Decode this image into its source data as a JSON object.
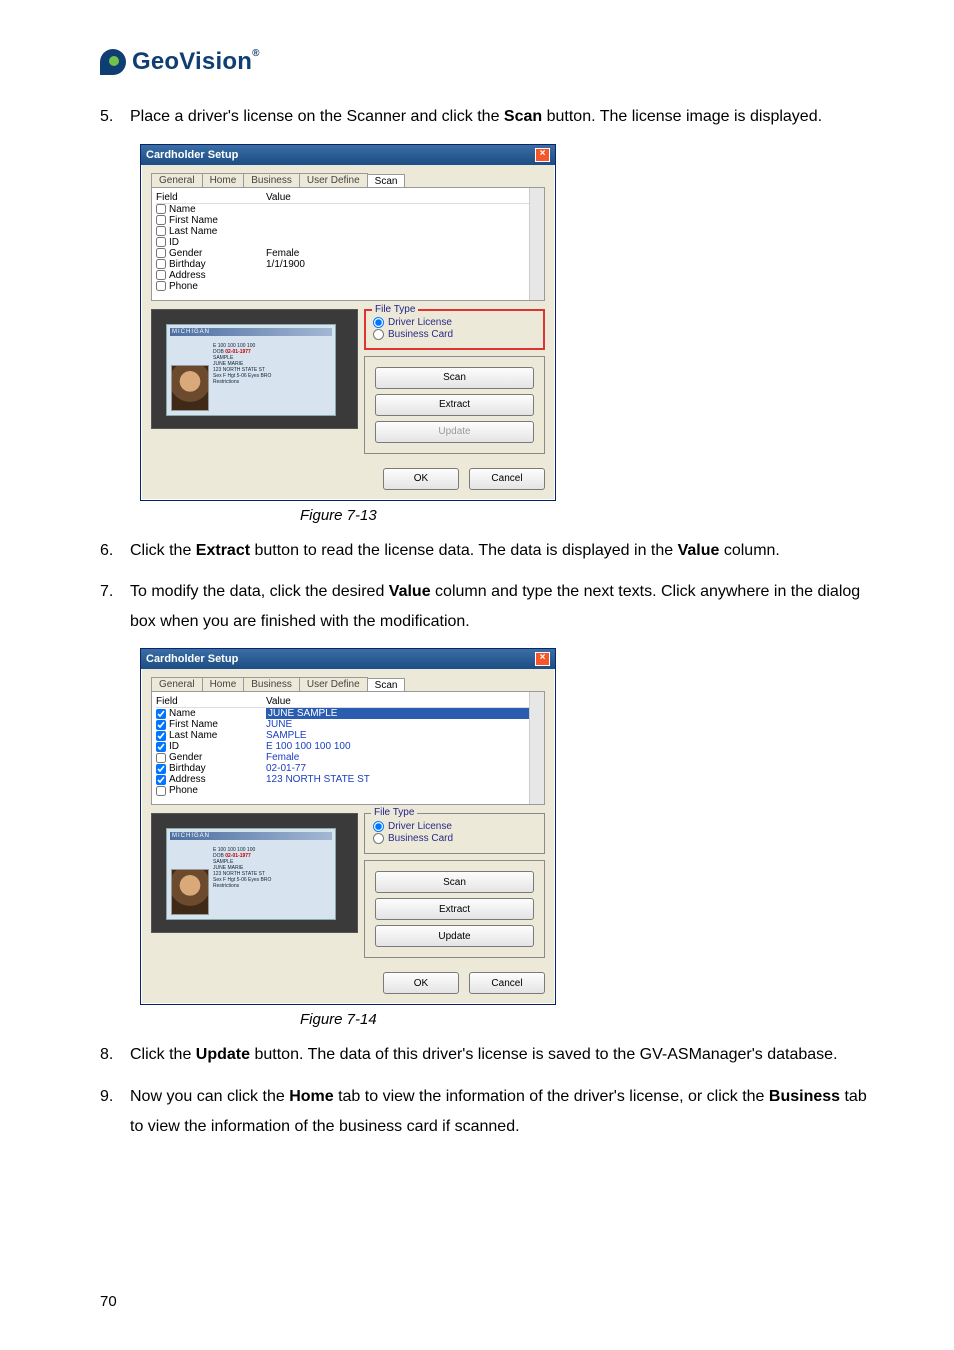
{
  "logo": {
    "text": "GeoVision",
    "tm": "®"
  },
  "steps": {
    "s5": {
      "num": "5.",
      "text_a": "Place a driver's license on the Scanner and click the ",
      "b1": "Scan",
      "text_b": " button. The license image is displayed."
    },
    "s6": {
      "num": "6.",
      "text_a": "Click the ",
      "b1": "Extract",
      "text_b": " button to read the license data. The data is displayed in the ",
      "b2": "Value",
      "text_c": " column."
    },
    "s7": {
      "num": "7.",
      "text_a": "To modify the data, click the desired ",
      "b1": "Value",
      "text_b": " column and type the next texts. Click anywhere in the dialog box when you are finished with the modification."
    },
    "s8": {
      "num": "8.",
      "text_a": "Click the ",
      "b1": "Update",
      "text_b": " button. The data of this driver's license is saved to the GV-ASManager's database."
    },
    "s9": {
      "num": "9.",
      "text_a": "Now you can click the ",
      "b1": "Home",
      "text_b": " tab to view the information of the driver's license, or click the ",
      "b2": "Business",
      "text_c": " tab to view the information of the business card if scanned."
    }
  },
  "captions": {
    "c1": "Figure 7-13",
    "c2": "Figure 7-14"
  },
  "page_number": "70",
  "dialog": {
    "title": "Cardholder Setup",
    "tabs": {
      "general": "General",
      "home": "Home",
      "business": "Business",
      "user": "User Define",
      "scan": "Scan"
    },
    "headers": {
      "field": "Field",
      "value": "Value"
    },
    "fields": {
      "name": "Name",
      "first": "First Name",
      "last": "Last Name",
      "id": "ID",
      "gender": "Gender",
      "birthday": "Birthday",
      "address": "Address",
      "phone": "Phone"
    },
    "filetype": {
      "legend": "File Type",
      "driver": "Driver License",
      "bcard": "Business Card"
    },
    "buttons": {
      "scan": "Scan",
      "extract": "Extract",
      "update": "Update",
      "ok": "OK",
      "cancel": "Cancel"
    },
    "license_bar": "MICHIGAN"
  },
  "d1": {
    "rows": {
      "name": "",
      "first": "",
      "last": "",
      "id": "",
      "gender": "Female",
      "birthday": "1/1/1900",
      "address": "",
      "phone": ""
    },
    "checked": {
      "name": false,
      "first": false,
      "last": false,
      "id": false,
      "gender": false,
      "birthday": false,
      "address": false,
      "phone": false
    },
    "update_disabled": true
  },
  "d2": {
    "rows": {
      "name": "JUNE SAMPLE",
      "first": "JUNE",
      "last": "SAMPLE",
      "id": "E 100 100 100 100",
      "gender": "Female",
      "birthday": "02-01-77",
      "address": "123 NORTH STATE ST",
      "phone": ""
    },
    "checked": {
      "name": true,
      "first": true,
      "last": true,
      "id": true,
      "gender": false,
      "birthday": true,
      "address": true,
      "phone": false
    },
    "update_disabled": false
  },
  "license_lines": {
    "l1": "E 100 100 100 100",
    "l2_a": "DOB ",
    "l2_b": "02-01-1977",
    "l3": "SAMPLE",
    "l4": "JUNE MARIE",
    "l5": "123 NORTH STATE ST",
    "sex": "Sex F   Hgt 5-06   Eyes BRO",
    "restr": "Restrictions"
  }
}
